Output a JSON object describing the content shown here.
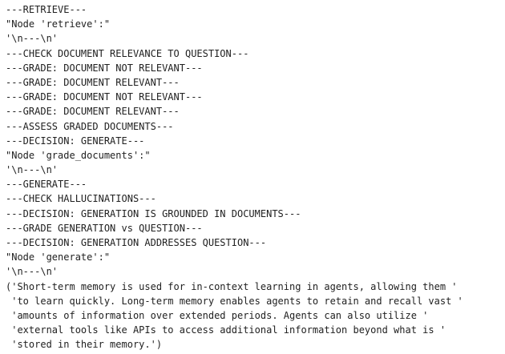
{
  "output": {
    "lines": [
      "---RETRIEVE---",
      "\"Node 'retrieve':\"",
      "'\\n---\\n'",
      "---CHECK DOCUMENT RELEVANCE TO QUESTION---",
      "---GRADE: DOCUMENT NOT RELEVANT---",
      "---GRADE: DOCUMENT RELEVANT---",
      "---GRADE: DOCUMENT NOT RELEVANT---",
      "---GRADE: DOCUMENT RELEVANT---",
      "---ASSESS GRADED DOCUMENTS---",
      "---DECISION: GENERATE---",
      "\"Node 'grade_documents':\"",
      "'\\n---\\n'",
      "---GENERATE---",
      "---CHECK HALLUCINATIONS---",
      "---DECISION: GENERATION IS GROUNDED IN DOCUMENTS---",
      "---GRADE GENERATION vs QUESTION---",
      "---DECISION: GENERATION ADDRESSES QUESTION---",
      "\"Node 'generate':\"",
      "'\\n---\\n'",
      "('Short-term memory is used for in-context learning in agents, allowing them '",
      " 'to learn quickly. Long-term memory enables agents to retain and recall vast '",
      " 'amounts of information over extended periods. Agents can also utilize '",
      " 'external tools like APIs to access additional information beyond what is '",
      " 'stored in their memory.')"
    ]
  }
}
